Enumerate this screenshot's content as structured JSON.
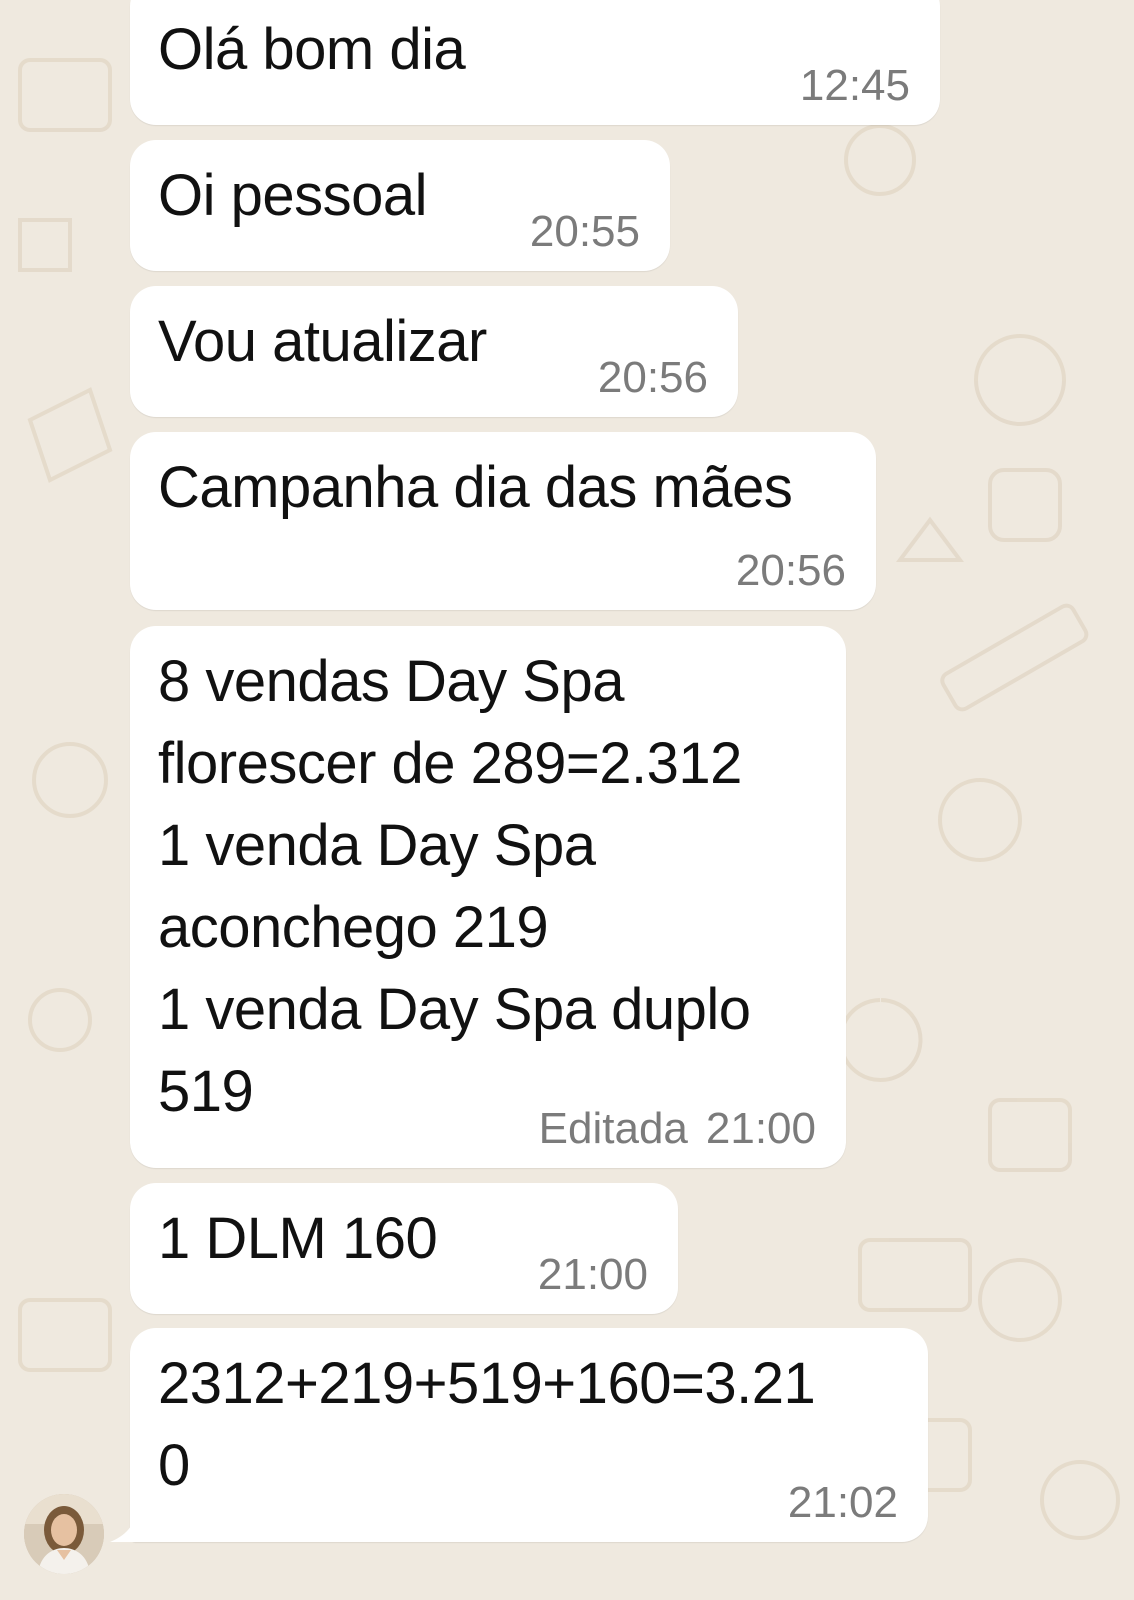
{
  "chat": {
    "messages": [
      {
        "text": "Olá bom dia",
        "time": "12:45"
      },
      {
        "text": "Oi pessoal",
        "time": "20:55"
      },
      {
        "text": "Vou atualizar",
        "time": "20:56"
      },
      {
        "text": "Campanha dia das mães",
        "time": "20:56"
      },
      {
        "lines": [
          "8 vendas Day Spa",
          "florescer de 289=2.312",
          "1 venda Day Spa",
          "aconchego 219",
          "1 venda Day Spa duplo",
          "519"
        ],
        "edited_label": "Editada",
        "time": "21:00"
      },
      {
        "text": "1 DLM 160",
        "time": "21:00"
      },
      {
        "lines": [
          "2312+219+519+160=3.21",
          "0"
        ],
        "time": "21:02"
      }
    ]
  },
  "colors": {
    "wallpaper": "#efe9df",
    "bubble": "#ffffff",
    "text": "#111111",
    "timestamp": "#7b7b7b"
  }
}
